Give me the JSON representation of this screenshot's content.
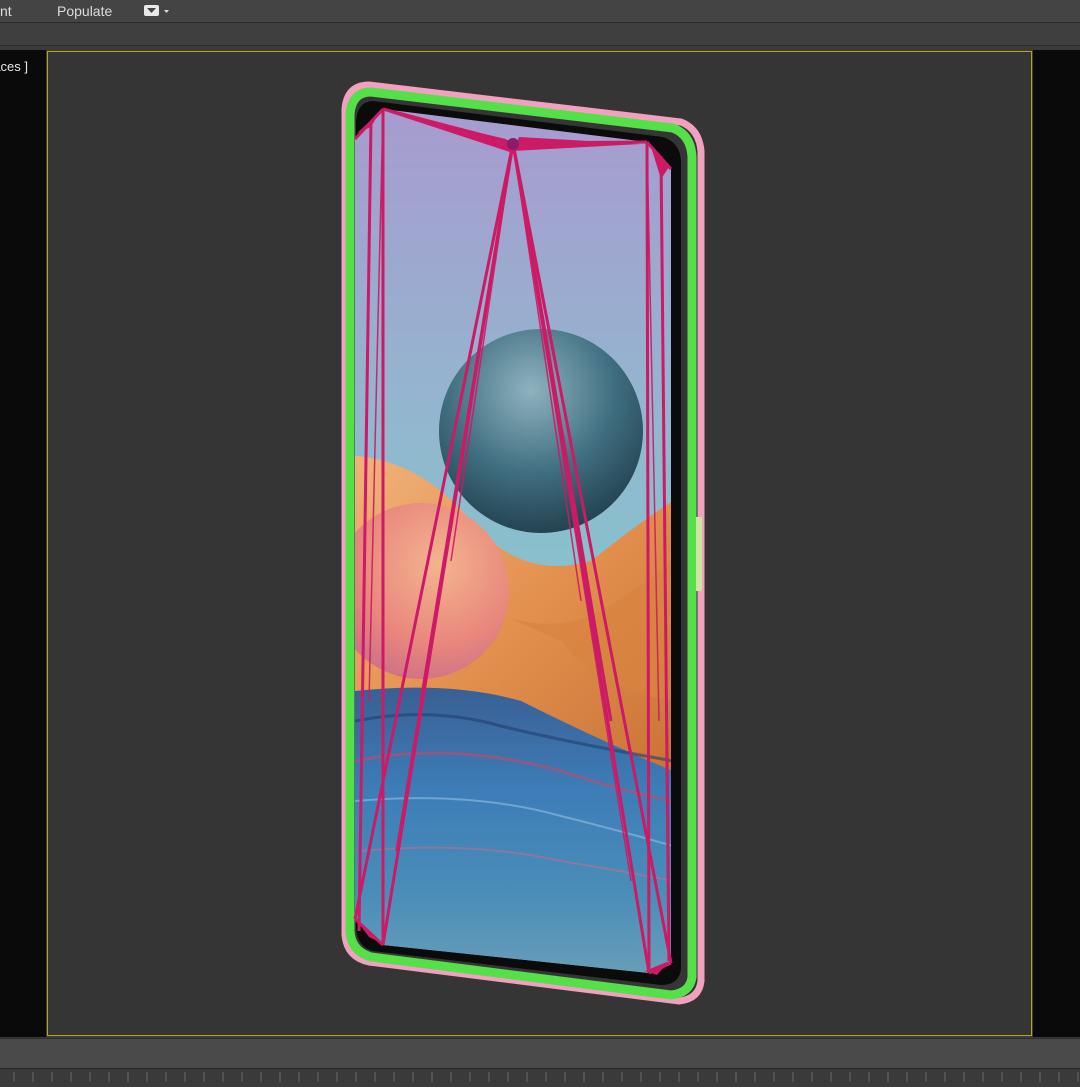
{
  "menubar": {
    "items": [
      {
        "label": "nt"
      },
      {
        "label": "Populate"
      }
    ],
    "dropdown_icon": "display-dropdown-icon"
  },
  "viewport": {
    "label_fragment": "aces ]",
    "border_color": "#b6a520",
    "object": "smartphone-model",
    "wireframe_color": "#cc1a66",
    "edge_colors": {
      "green": "#55e04a",
      "pink": "#f2a0bf"
    }
  }
}
